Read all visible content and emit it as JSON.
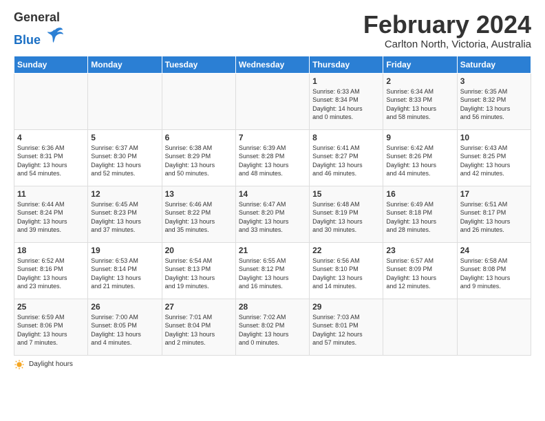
{
  "header": {
    "logo_general": "General",
    "logo_blue": "Blue",
    "month_title": "February 2024",
    "location": "Carlton North, Victoria, Australia"
  },
  "days_of_week": [
    "Sunday",
    "Monday",
    "Tuesday",
    "Wednesday",
    "Thursday",
    "Friday",
    "Saturday"
  ],
  "weeks": [
    [
      {
        "day": "",
        "info": ""
      },
      {
        "day": "",
        "info": ""
      },
      {
        "day": "",
        "info": ""
      },
      {
        "day": "",
        "info": ""
      },
      {
        "day": "1",
        "info": "Sunrise: 6:33 AM\nSunset: 8:34 PM\nDaylight: 14 hours\nand 0 minutes."
      },
      {
        "day": "2",
        "info": "Sunrise: 6:34 AM\nSunset: 8:33 PM\nDaylight: 13 hours\nand 58 minutes."
      },
      {
        "day": "3",
        "info": "Sunrise: 6:35 AM\nSunset: 8:32 PM\nDaylight: 13 hours\nand 56 minutes."
      }
    ],
    [
      {
        "day": "4",
        "info": "Sunrise: 6:36 AM\nSunset: 8:31 PM\nDaylight: 13 hours\nand 54 minutes."
      },
      {
        "day": "5",
        "info": "Sunrise: 6:37 AM\nSunset: 8:30 PM\nDaylight: 13 hours\nand 52 minutes."
      },
      {
        "day": "6",
        "info": "Sunrise: 6:38 AM\nSunset: 8:29 PM\nDaylight: 13 hours\nand 50 minutes."
      },
      {
        "day": "7",
        "info": "Sunrise: 6:39 AM\nSunset: 8:28 PM\nDaylight: 13 hours\nand 48 minutes."
      },
      {
        "day": "8",
        "info": "Sunrise: 6:41 AM\nSunset: 8:27 PM\nDaylight: 13 hours\nand 46 minutes."
      },
      {
        "day": "9",
        "info": "Sunrise: 6:42 AM\nSunset: 8:26 PM\nDaylight: 13 hours\nand 44 minutes."
      },
      {
        "day": "10",
        "info": "Sunrise: 6:43 AM\nSunset: 8:25 PM\nDaylight: 13 hours\nand 42 minutes."
      }
    ],
    [
      {
        "day": "11",
        "info": "Sunrise: 6:44 AM\nSunset: 8:24 PM\nDaylight: 13 hours\nand 39 minutes."
      },
      {
        "day": "12",
        "info": "Sunrise: 6:45 AM\nSunset: 8:23 PM\nDaylight: 13 hours\nand 37 minutes."
      },
      {
        "day": "13",
        "info": "Sunrise: 6:46 AM\nSunset: 8:22 PM\nDaylight: 13 hours\nand 35 minutes."
      },
      {
        "day": "14",
        "info": "Sunrise: 6:47 AM\nSunset: 8:20 PM\nDaylight: 13 hours\nand 33 minutes."
      },
      {
        "day": "15",
        "info": "Sunrise: 6:48 AM\nSunset: 8:19 PM\nDaylight: 13 hours\nand 30 minutes."
      },
      {
        "day": "16",
        "info": "Sunrise: 6:49 AM\nSunset: 8:18 PM\nDaylight: 13 hours\nand 28 minutes."
      },
      {
        "day": "17",
        "info": "Sunrise: 6:51 AM\nSunset: 8:17 PM\nDaylight: 13 hours\nand 26 minutes."
      }
    ],
    [
      {
        "day": "18",
        "info": "Sunrise: 6:52 AM\nSunset: 8:16 PM\nDaylight: 13 hours\nand 23 minutes."
      },
      {
        "day": "19",
        "info": "Sunrise: 6:53 AM\nSunset: 8:14 PM\nDaylight: 13 hours\nand 21 minutes."
      },
      {
        "day": "20",
        "info": "Sunrise: 6:54 AM\nSunset: 8:13 PM\nDaylight: 13 hours\nand 19 minutes."
      },
      {
        "day": "21",
        "info": "Sunrise: 6:55 AM\nSunset: 8:12 PM\nDaylight: 13 hours\nand 16 minutes."
      },
      {
        "day": "22",
        "info": "Sunrise: 6:56 AM\nSunset: 8:10 PM\nDaylight: 13 hours\nand 14 minutes."
      },
      {
        "day": "23",
        "info": "Sunrise: 6:57 AM\nSunset: 8:09 PM\nDaylight: 13 hours\nand 12 minutes."
      },
      {
        "day": "24",
        "info": "Sunrise: 6:58 AM\nSunset: 8:08 PM\nDaylight: 13 hours\nand 9 minutes."
      }
    ],
    [
      {
        "day": "25",
        "info": "Sunrise: 6:59 AM\nSunset: 8:06 PM\nDaylight: 13 hours\nand 7 minutes."
      },
      {
        "day": "26",
        "info": "Sunrise: 7:00 AM\nSunset: 8:05 PM\nDaylight: 13 hours\nand 4 minutes."
      },
      {
        "day": "27",
        "info": "Sunrise: 7:01 AM\nSunset: 8:04 PM\nDaylight: 13 hours\nand 2 minutes."
      },
      {
        "day": "28",
        "info": "Sunrise: 7:02 AM\nSunset: 8:02 PM\nDaylight: 13 hours\nand 0 minutes."
      },
      {
        "day": "29",
        "info": "Sunrise: 7:03 AM\nSunset: 8:01 PM\nDaylight: 12 hours\nand 57 minutes."
      },
      {
        "day": "",
        "info": ""
      },
      {
        "day": "",
        "info": ""
      }
    ]
  ],
  "footer": {
    "daylight_label": "Daylight hours"
  }
}
